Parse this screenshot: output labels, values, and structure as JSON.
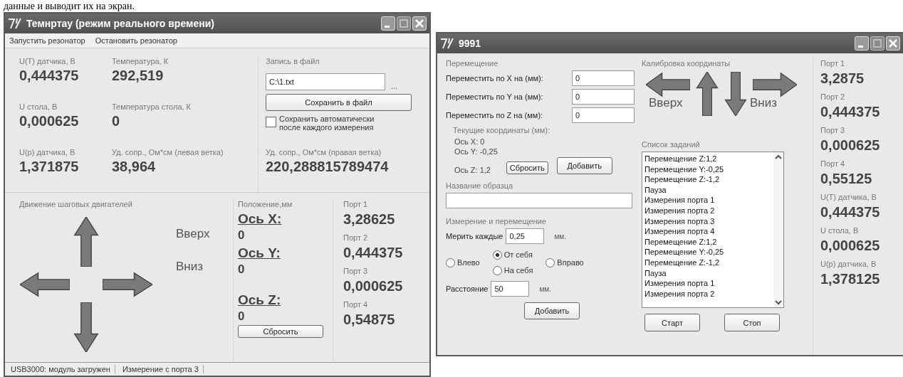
{
  "caption": "данные и выводит их на экран.",
  "temp_window": {
    "title": "Темнртау (режим реального времени)",
    "menu": [
      "Запустить резонатор",
      "Остановить резонатор"
    ],
    "readings": [
      {
        "label": "U(T) датчика, В",
        "value": "0,444375"
      },
      {
        "label": "Температура, К",
        "value": "292,519"
      },
      {
        "label": "U стола, В",
        "value": "0,000625"
      },
      {
        "label": "Температура стола, К",
        "value": "0"
      },
      {
        "label": "U(p) датчика, В",
        "value": "1,371875"
      },
      {
        "label": "Уд. сопр., Ом*см (левая ветка)",
        "value": "38,964"
      }
    ],
    "file": {
      "label": "Запись в файл",
      "path": "C:\\1.txt",
      "browse": "...",
      "save_button": "Сохранить в файл",
      "auto_save": {
        "label": "Сохранить автоматически после каждого измерения",
        "checked": false
      }
    },
    "resistance_right": {
      "label": "Уд. сопр., Ом*см (правая ветка)",
      "value": "220,288815789474"
    },
    "motors": {
      "label": "Движение шаговых двигателей",
      "up_label": "Вверх",
      "down_label": "Вниз"
    },
    "position": {
      "label": "Положение,мм",
      "axes": [
        {
          "label": "Ось X:",
          "value": "0"
        },
        {
          "label": "Ось Y:",
          "value": "0"
        },
        {
          "label": "Ось Z:",
          "value": "0"
        }
      ],
      "reset_button": "Сбросить"
    },
    "ports": [
      {
        "label": "Порт 1",
        "value": "3,28625"
      },
      {
        "label": "Порт 2",
        "value": "0,444375"
      },
      {
        "label": "Порт 3",
        "value": "0,000625"
      },
      {
        "label": "Порт 4",
        "value": "0,54875"
      }
    ],
    "status_bar": [
      "USB3000: модуль загружен",
      "Измерение с порта 3"
    ]
  },
  "task_window": {
    "title": "9991",
    "move": {
      "label": "Перемещение",
      "rows": [
        {
          "label": "Переместить по X на (мм):",
          "value": "0"
        },
        {
          "label": "Переместить по Y на (мм):",
          "value": "0"
        },
        {
          "label": "Переместить по Z на (мм):",
          "value": "0"
        }
      ],
      "current_label": "Текущие координаты (мм):",
      "coords": [
        {
          "label": "Ось X:",
          "value": "0"
        },
        {
          "label": "Ось Y:",
          "value": "-0,25"
        },
        {
          "label": "Ось Z:",
          "value": "1,2"
        }
      ],
      "reset_button": "Сбросить",
      "add_button": "Добавить"
    },
    "sample": {
      "label": "Название образца"
    },
    "measure": {
      "label": "Измерение и перемещение",
      "every_label": "Мерить каждые",
      "every_value": "0,25",
      "every_unit": "мм.",
      "radios": [
        {
          "label": "Влево",
          "selected": false
        },
        {
          "label": "От себя",
          "selected": true
        },
        {
          "label": "На себя",
          "selected": false
        },
        {
          "label": "Вправо",
          "selected": false
        }
      ],
      "distance_label": "Расстояние",
      "distance_value": "50",
      "distance_unit": "мм.",
      "add_button": "Добавить"
    },
    "calibration": {
      "label": "Калибровка координаты",
      "up_label": "Вверх",
      "down_label": "Вниз"
    },
    "tasks": {
      "label": "Список заданий",
      "items": [
        "Перемещение Z:1,2",
        "Перемещение Y:-0,25",
        "Перемещение Z:-1,2",
        "Пауза",
        "Измерения порта 1",
        "Измерения порта 2",
        "Измерения порта 3",
        "Измерения порта 4",
        "Перемещение Z:1,2",
        "Перемещение Y:-0,25",
        "Перемещение Z:-1,2",
        "Пауза",
        "Измерения порта 1",
        "Измерения порта 2"
      ]
    },
    "start_button": "Старт",
    "stop_button": "Стоп",
    "readings": [
      {
        "label": "Порт 1",
        "value": "3,2875"
      },
      {
        "label": "Порт 2",
        "value": "0,444375"
      },
      {
        "label": "Порт 3",
        "value": "0,000625"
      },
      {
        "label": "Порт 4",
        "value": "0,55125"
      },
      {
        "label": "U(T) датчика, В",
        "value": "0,444375"
      },
      {
        "label": "U стола, В",
        "value": "0,000625"
      },
      {
        "label": "U(p) датчика, В",
        "value": "1,378125"
      }
    ]
  }
}
